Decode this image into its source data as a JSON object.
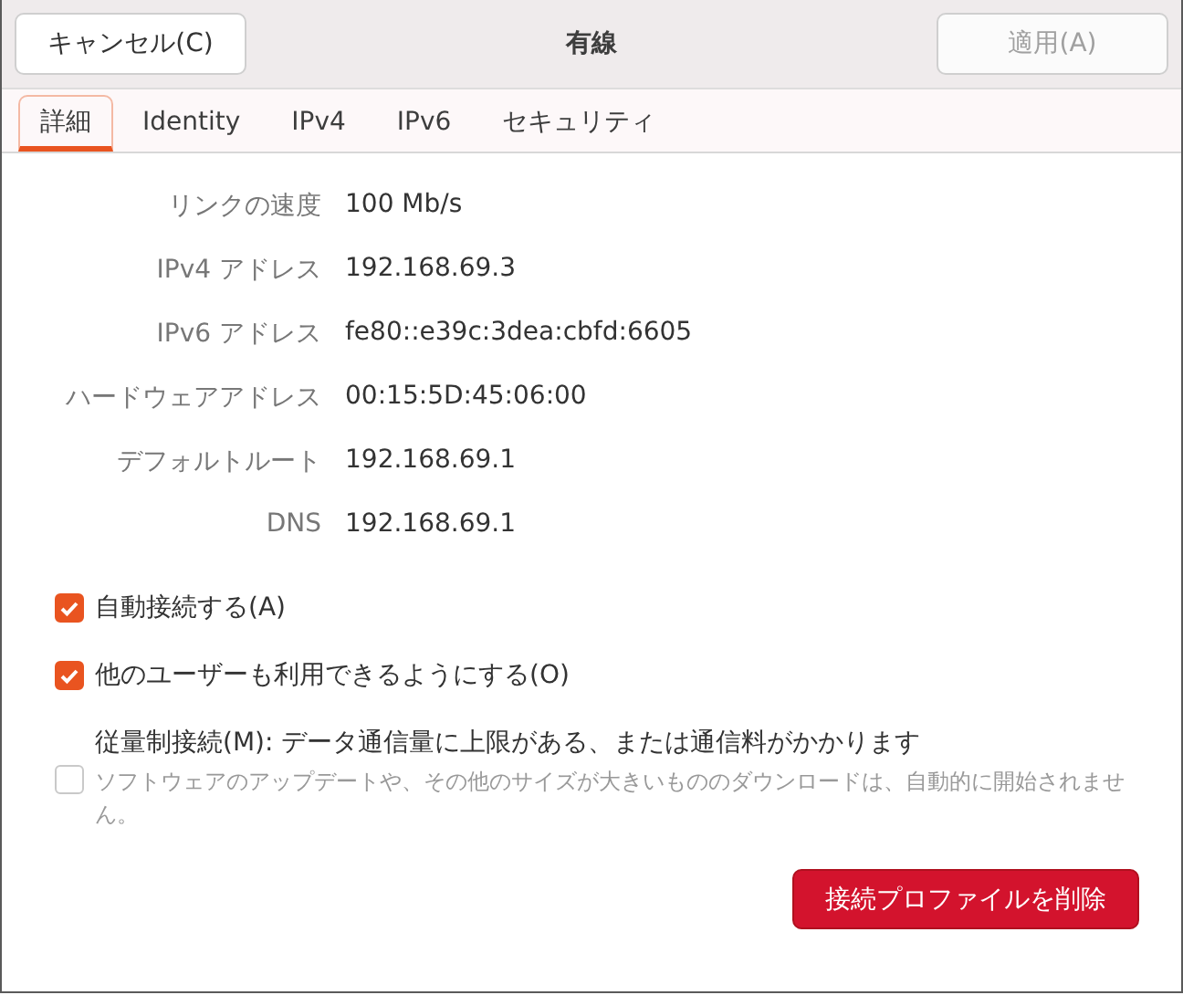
{
  "header": {
    "cancel": "キャンセル(C)",
    "title": "有線",
    "apply": {
      "label": "適用(A)",
      "disabled": true
    }
  },
  "tabs": [
    {
      "label": "詳細",
      "selected": true
    },
    {
      "label": "Identity",
      "selected": false
    },
    {
      "label": "IPv4",
      "selected": false
    },
    {
      "label": "IPv6",
      "selected": false
    },
    {
      "label": "セキュリティ",
      "selected": false
    }
  ],
  "details": [
    {
      "label": "リンクの速度",
      "value": "100 Mb/s"
    },
    {
      "label": "IPv4 アドレス",
      "value": "192.168.69.3"
    },
    {
      "label": "IPv6 アドレス",
      "value": "fe80::e39c:3dea:cbfd:6605"
    },
    {
      "label": "ハードウェアアドレス",
      "value": "00:15:5D:45:06:00"
    },
    {
      "label": "デフォルトルート",
      "value": "192.168.69.1"
    },
    {
      "label": "DNS",
      "value": "192.168.69.1"
    }
  ],
  "options": [
    {
      "label": "自動接続する(A)",
      "checked": true
    },
    {
      "label": "他のユーザーも利用できるようにする(O)",
      "checked": true
    },
    {
      "label": "従量制接続(M): データ通信量に上限がある、または通信料がかかります",
      "description": "ソフトウェアのアップデートや、その他のサイズが大きいもののダウンロードは、自動的に開始されません。",
      "checked": false
    }
  ],
  "delete_button": "接続プロファイルを削除"
}
